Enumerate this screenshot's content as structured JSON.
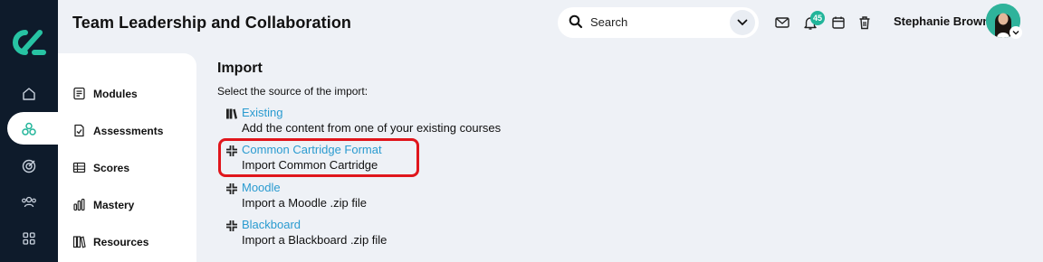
{
  "header": {
    "title": "Team Leadership and Collaboration",
    "search_placeholder": "Search",
    "notification_count": "45",
    "user_name": "Stephanie Brown"
  },
  "rail": {
    "icons": [
      "home-icon",
      "courses-icon",
      "target-icon",
      "users-icon",
      "apps-icon"
    ],
    "active": "courses-icon"
  },
  "subnav": {
    "items": [
      {
        "label": "Modules",
        "icon": "modules-icon"
      },
      {
        "label": "Assessments",
        "icon": "assessments-icon"
      },
      {
        "label": "Scores",
        "icon": "scores-icon"
      },
      {
        "label": "Mastery",
        "icon": "mastery-icon"
      },
      {
        "label": "Resources",
        "icon": "resources-icon"
      }
    ]
  },
  "main": {
    "heading": "Import",
    "subtitle": "Select the source of the import:",
    "options": [
      {
        "label": "Existing",
        "description": "Add the content from one of your existing courses",
        "icon": "books-icon"
      },
      {
        "label": "Common Cartridge Format",
        "description": "Import Common Cartridge",
        "icon": "import-arrows-icon",
        "highlighted": true
      },
      {
        "label": "Moodle",
        "description": "Import a Moodle .zip file",
        "icon": "import-arrows-icon"
      },
      {
        "label": "Blackboard",
        "description": "Import a Blackboard .zip file",
        "icon": "import-arrows-icon"
      }
    ]
  },
  "colors": {
    "rail": "#0e1b2b",
    "accent": "#22b59a",
    "link": "#2a9bd0",
    "highlight": "#e0161c",
    "background": "#eef1f6"
  }
}
